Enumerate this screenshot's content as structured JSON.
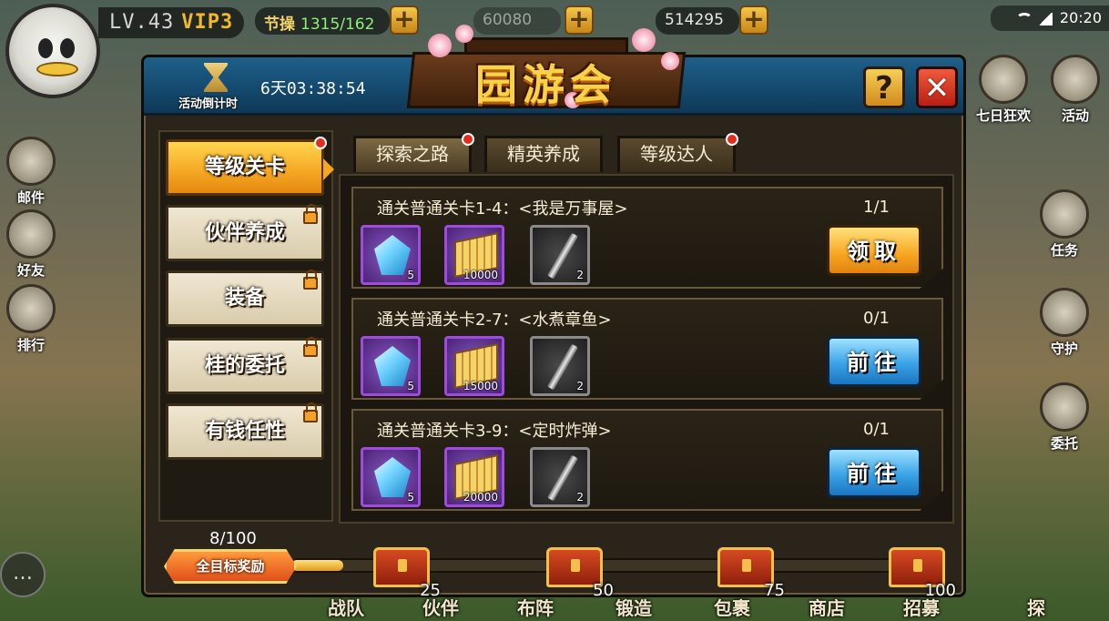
{
  "hud": {
    "level": "LV.43",
    "vip": "VIP3",
    "resources": [
      {
        "label": "节操",
        "value": "1315/162"
      },
      {
        "label": "",
        "value": "60080"
      },
      {
        "label": "",
        "value": "514295"
      }
    ],
    "time": "20:20"
  },
  "side_icons_left": [
    "邮件",
    "好友",
    "排行"
  ],
  "side_icons_right": [
    "七日狂欢",
    "活动",
    "任务",
    "守护",
    "委托"
  ],
  "bottom_nav": [
    "战队",
    "伙伴",
    "布阵",
    "锻造",
    "包裹",
    "商店",
    "招募",
    "探索"
  ],
  "dialog": {
    "title": "园游会",
    "countdown_label": "活动倒计时",
    "countdown_time": "6天03:38:54",
    "help_label": "?",
    "close_label": "✕",
    "sidebar": [
      {
        "label": "等级关卡",
        "active": true,
        "locked": false,
        "dot": true
      },
      {
        "label": "伙伴养成",
        "active": false,
        "locked": true,
        "dot": false
      },
      {
        "label": "装备",
        "active": false,
        "locked": true,
        "dot": false
      },
      {
        "label": "桂的委托",
        "active": false,
        "locked": true,
        "dot": false
      },
      {
        "label": "有钱任性",
        "active": false,
        "locked": true,
        "dot": false
      }
    ],
    "tabs": [
      {
        "label": "探索之路",
        "active": true,
        "dot": true
      },
      {
        "label": "精英养成",
        "active": false,
        "dot": false
      },
      {
        "label": "等级达人",
        "active": false,
        "dot": true
      }
    ],
    "tasks": [
      {
        "title": "通关普通关卡1-4：<我是万事屋>",
        "progress": "1/1",
        "rewards": [
          {
            "icon": "crystal-icon",
            "count": "5"
          },
          {
            "icon": "gold-icon",
            "count": "10000"
          },
          {
            "icon": "sword-icon",
            "count": "2"
          }
        ],
        "button": "领取",
        "button_type": "claim"
      },
      {
        "title": "通关普通关卡2-7：<水煮章鱼>",
        "progress": "0/1",
        "rewards": [
          {
            "icon": "crystal-icon",
            "count": "5"
          },
          {
            "icon": "gold-icon",
            "count": "15000"
          },
          {
            "icon": "sword-icon",
            "count": "2"
          }
        ],
        "button": "前往",
        "button_type": "goto"
      },
      {
        "title": "通关普通关卡3-9：<定时炸弹>",
        "progress": "0/1",
        "rewards": [
          {
            "icon": "crystal-icon",
            "count": "5"
          },
          {
            "icon": "gold-icon",
            "count": "20000"
          },
          {
            "icon": "sword-icon",
            "count": "2"
          }
        ],
        "button": "前往",
        "button_type": "goto"
      }
    ],
    "goal": {
      "count": "8/100",
      "badge": "全目标奖励",
      "progress_fraction": 0.08,
      "chests": [
        "25",
        "50",
        "75",
        "100"
      ]
    }
  },
  "colors": {
    "claim_button": "#f7a51f",
    "goto_button": "#3aa3e6",
    "header_blue": "#154c72",
    "accent_gold": "#f8d347"
  }
}
